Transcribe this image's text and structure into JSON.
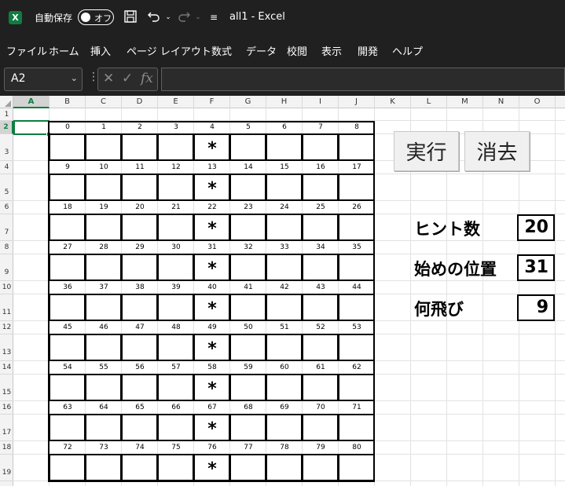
{
  "titlebar": {
    "app_badge": "X",
    "autosave_label": "自動保存",
    "autosave_state": "オフ",
    "doc_title": "all1  -  Excel"
  },
  "menu": [
    "ファイル",
    "ホーム",
    "挿入",
    "ページ レイアウト",
    "数式",
    "データ",
    "校閲",
    "表示",
    "開発",
    "ヘルプ"
  ],
  "formula_bar": {
    "name_box": "A2",
    "formula": ""
  },
  "columns": [
    "A",
    "B",
    "C",
    "D",
    "E",
    "F",
    "G",
    "H",
    "I",
    "J",
    "K",
    "L",
    "M",
    "N",
    "O"
  ],
  "rows": [
    "1",
    "2",
    "3",
    "4",
    "5",
    "6",
    "7",
    "8",
    "9",
    "10",
    "11",
    "12",
    "13",
    "14",
    "15",
    "16",
    "17",
    "18",
    "19"
  ],
  "selected_column": "A",
  "selected_row": "2",
  "grid_numbers": [
    [
      0,
      1,
      2,
      3,
      4,
      5,
      6,
      7,
      8
    ],
    [
      9,
      10,
      11,
      12,
      13,
      14,
      15,
      16,
      17
    ],
    [
      18,
      19,
      20,
      21,
      22,
      23,
      24,
      25,
      26
    ],
    [
      27,
      28,
      29,
      30,
      31,
      32,
      33,
      34,
      35
    ],
    [
      36,
      37,
      38,
      39,
      40,
      41,
      42,
      43,
      44
    ],
    [
      45,
      46,
      47,
      48,
      49,
      50,
      51,
      52,
      53
    ],
    [
      54,
      55,
      56,
      57,
      58,
      59,
      60,
      61,
      62
    ],
    [
      63,
      64,
      65,
      66,
      67,
      68,
      69,
      70,
      71
    ],
    [
      72,
      73,
      74,
      75,
      76,
      77,
      78,
      79,
      80
    ]
  ],
  "star_symbol": "*",
  "star_column_index": 4,
  "buttons": {
    "run": "実行",
    "clear": "消去"
  },
  "panel": {
    "hint_label": "ヒント数",
    "hint_value": "20",
    "start_label": "始めの位置",
    "start_value": "31",
    "skip_label": "何飛び",
    "skip_value": "9"
  },
  "colors": {
    "accent": "#107c41",
    "dark_chrome": "#202020"
  }
}
